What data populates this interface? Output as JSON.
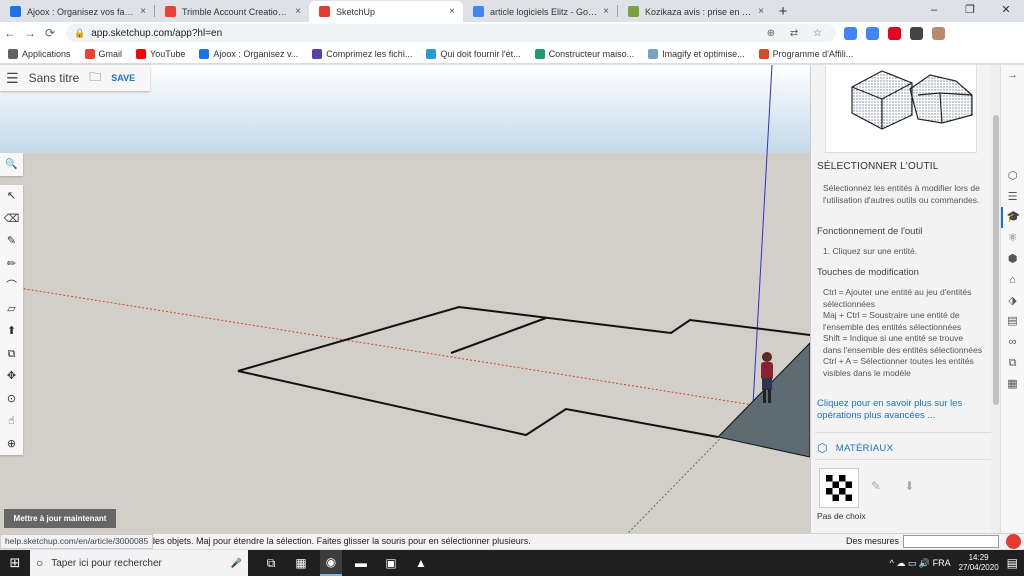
{
  "browser": {
    "tabs": [
      {
        "title": "Ajoox : Organisez vos favoris et g",
        "favicon_color": "#1a73e8",
        "active": false
      },
      {
        "title": "Trimble Account Creation Notific",
        "favicon_color": "#ea4335",
        "active": false
      },
      {
        "title": "SketchUp",
        "favicon_color": "#e03c31",
        "active": true
      },
      {
        "title": "article logiciels Elitz - Google Do",
        "favicon_color": "#4285f4",
        "active": false
      },
      {
        "title": "Kozikaza avis : prise en main pou",
        "favicon_color": "#7aa23f",
        "active": false
      }
    ],
    "close_glyph": "×",
    "new_tab_glyph": "+",
    "window_controls": [
      "–",
      "❐",
      "✕"
    ],
    "url": "app.sketchup.com/app?hl=en",
    "nav": {
      "back": "←",
      "forward": "→",
      "reload": "⟳"
    },
    "omnibox_icons": "⊕ ⇄ ☆",
    "lock_glyph": "🔒",
    "extension_colors": [
      "#4285f4",
      "#4285f4",
      "#e60023",
      "#444444",
      "#b98a6b"
    ],
    "bookmarks": [
      {
        "label": "Applications",
        "color": "#5f6368"
      },
      {
        "label": "Gmail",
        "color": "#ea4335"
      },
      {
        "label": "YouTube",
        "color": "#ff0000"
      },
      {
        "label": "Ajoox : Organisez v...",
        "color": "#1a73e8"
      },
      {
        "label": "Comprimez les fichi...",
        "color": "#5b3fa8"
      },
      {
        "label": "Qui doit fournir l'ét...",
        "color": "#2a9ad6"
      },
      {
        "label": "Constructeur maiso...",
        "color": "#1f9b6a"
      },
      {
        "label": "Imagify et optimise...",
        "color": "#7aa0c4"
      },
      {
        "label": "Programme d'Affili...",
        "color": "#d34a2b"
      }
    ]
  },
  "app": {
    "menu_icon": "☰",
    "title": "Sans titre",
    "folder_icon": "🗀",
    "save_label": "SAVE",
    "search_icon": "🔍",
    "tools": [
      "↖",
      "⌫",
      "✎",
      "✏",
      "⌒",
      "▱",
      "⬆",
      "⧉",
      "✥",
      "⊙",
      "☝",
      "⊕"
    ],
    "update_button": "Mettre à jour maintenant",
    "status_hint": "z des objets. Maj pour étendre la sélection. Faites glisser la souris pour en sélectionner plusieurs.",
    "status_url": "help.sketchup.com/en/article/3000085",
    "measures_label": "Des mesures",
    "measures_value": "",
    "right_tray_icons": [
      "⬡",
      "☰",
      "🎓",
      "⚛",
      "⬢",
      "⌂",
      "⬗",
      "▤",
      "∞",
      "⧉",
      "▦"
    ],
    "collapse_icon": "→"
  },
  "panel": {
    "heading": "SÉLECTIONNER L'OUTIL",
    "description": "Sélectionnez les entités à modifier lors de l'utilisation d'autres outils ou commandes.",
    "operation_title": "Fonctionnement de l'outil",
    "operation_step": "1. Cliquez sur une entité.",
    "modifier_title": "Touches de modification",
    "modifiers": [
      "Ctrl = Ajouter une entité au jeu d'entités sélectionnées",
      "Maj + Ctrl = Soustraire une entité de l'ensemble des entités sélectionnées",
      "Shift = Indique si une entité se trouve dans l'ensemble des entités sélectionnées",
      "Ctrl + A = Sélectionner toutes les entités visibles dans le modèle"
    ],
    "learn_more": "Cliquez pour en savoir plus sur les opérations plus avancées ...",
    "materials_title": "MATÉRIAUX",
    "materials_icon": "⬡",
    "material_actions": "✎ ⬇",
    "no_choice": "Pas de choix"
  },
  "taskbar": {
    "start_icon": "⊞",
    "search_placeholder": "Taper ici pour rechercher",
    "search_icon": "○",
    "mic_icon": "🎤",
    "apps": [
      "⧉",
      "▦",
      "◉",
      "▬",
      "▣",
      "▲"
    ],
    "tray_icons": "^ ☁ ▭ 🔊 FRA",
    "time": "14:29",
    "date": "27/04/2020",
    "notification_icon": "▤"
  }
}
